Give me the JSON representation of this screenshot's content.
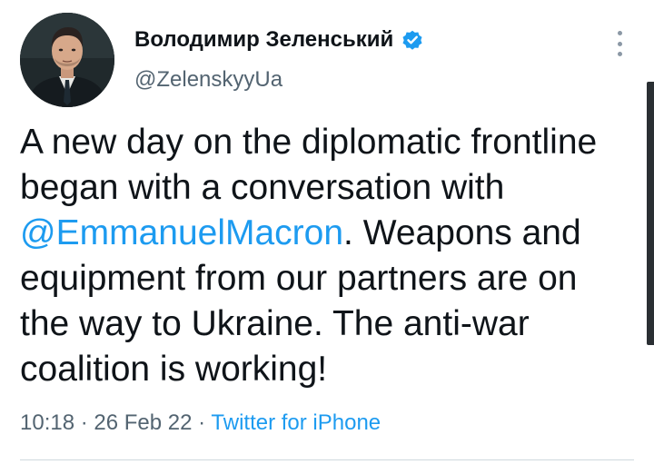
{
  "author": {
    "display_name": "Володимир Зеленський",
    "handle": "@ZelenskyyUa",
    "verified": true,
    "avatar_icon": "person-portrait-avatar"
  },
  "tweet": {
    "lines": [
      "A new day on the diplomatic frontline",
      "began with a conversation with",
      "",
      "equipment from our partners are on",
      "the way to Ukraine. The anti-war",
      "coalition is working!"
    ],
    "mention": "@EmmanuelMacron",
    "mention_line_rest": ". Weapons and"
  },
  "meta": {
    "time": "10:18",
    "separator": "·",
    "date": "26 Feb 22",
    "source": "Twitter for iPhone"
  },
  "icons": {
    "verified": "verified-badge-icon",
    "more": "more-options-icon"
  },
  "colors": {
    "link": "#1d9bf0",
    "secondary_text": "#536471",
    "primary_text": "#0f1419"
  }
}
